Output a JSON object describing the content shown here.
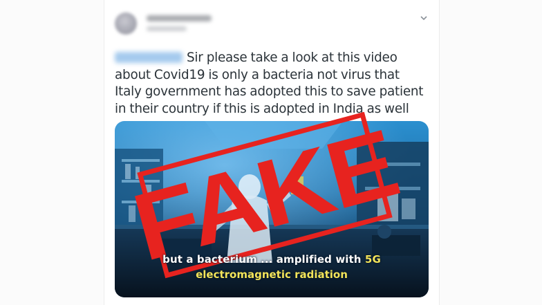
{
  "tweet": {
    "text": "Sir please take a look at this video about Covid19 is only a bacteria not virus that Italy government has adopted this to save patient in their country if this is adopted in India as well",
    "menu_icon": "chevron-down-icon"
  },
  "media": {
    "caption_line1_prefix": "but a bacterium ... amplified with ",
    "caption_line1_highlight": "5G",
    "caption_line2": "electromagnetic radiation",
    "stamp_text": "FAKE",
    "stamp_color": "#e7231f",
    "caption_highlight_color": "#f3e45a"
  },
  "colors": {
    "text": "#2b3339",
    "muted": "#8a9199"
  }
}
